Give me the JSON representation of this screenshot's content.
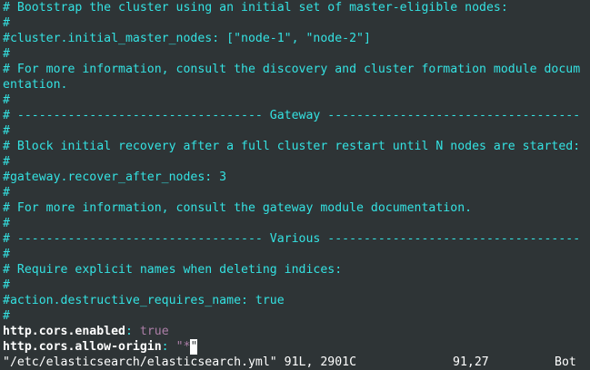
{
  "lines": [
    "# Bootstrap the cluster using an initial set of master-eligible nodes:",
    "#",
    "#cluster.initial_master_nodes: [\"node-1\", \"node-2\"]",
    "#",
    "# For more information, consult the discovery and cluster formation module docum",
    "entation.",
    "#",
    "# ---------------------------------- Gateway -----------------------------------",
    "#",
    "# Block initial recovery after a full cluster restart until N nodes are started:",
    "#",
    "#gateway.recover_after_nodes: 3",
    "#",
    "# For more information, consult the gateway module documentation.",
    "#",
    "# ---------------------------------- Various -----------------------------------",
    "#",
    "# Require explicit names when deleting indices:",
    "#",
    "#action.destructive_requires_name: true",
    "#"
  ],
  "settings": {
    "cors_enabled_key": "http.cors.enabled",
    "cors_enabled_sep": ": ",
    "cors_enabled_value": "true",
    "cors_origin_key": "http.cors.allow-origin",
    "cors_origin_sep": ": ",
    "cors_origin_value_open": "\"*",
    "cors_origin_value_cursor": "\""
  },
  "status": {
    "file": "\"/etc/elasticsearch/elasticsearch.yml\" 91L, 2901C",
    "position": "91,27",
    "scroll": "Bot"
  },
  "colors": {
    "background": "#2e3436",
    "comment": "#34e2e2",
    "value": "#ad7fa8",
    "text": "#ffffff"
  }
}
